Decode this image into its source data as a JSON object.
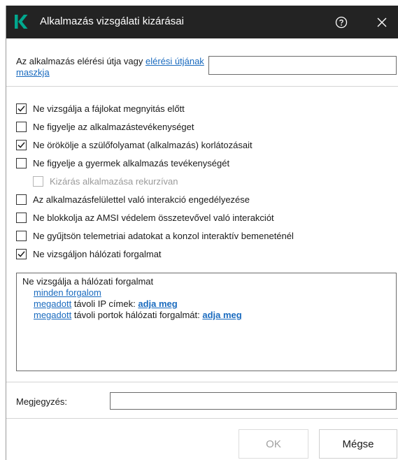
{
  "window": {
    "title": "Alkalmazás vizsgálati kizárásai",
    "accent_color": "#00a88e",
    "titlebar_color": "#232323",
    "icons": [
      "kaspersky-logo",
      "help-icon",
      "close-icon"
    ]
  },
  "path": {
    "label_prefix": "Az alkalmazás elérési útja vagy ",
    "label_link": "elérési útjának maszkja",
    "value": ""
  },
  "options": [
    {
      "label": "Ne vizsgálja a fájlokat megnyitás előtt",
      "checked": true,
      "disabled": false
    },
    {
      "label": "Ne figyelje az alkalmazástevékenységet",
      "checked": false,
      "disabled": false
    },
    {
      "label": "Ne örökölje a szülőfolyamat (alkalmazás) korlátozásait",
      "checked": true,
      "disabled": false
    },
    {
      "label": "Ne figyelje a gyermek alkalmazás tevékenységét",
      "checked": false,
      "disabled": false
    },
    {
      "label": "Kizárás alkalmazása rekurzívan",
      "checked": false,
      "disabled": true
    },
    {
      "label": "Az alkalmazásfelülettel való interakció engedélyezése",
      "checked": false,
      "disabled": false
    },
    {
      "label": "Ne blokkolja az AMSI védelem összetevővel való interakciót",
      "checked": false,
      "disabled": false
    },
    {
      "label": "Ne gyűjtsön telemetriai adatokat a konzol interaktív bemeneténél",
      "checked": false,
      "disabled": false
    },
    {
      "label": "Ne vizsgáljon hálózati forgalmat",
      "checked": true,
      "disabled": false
    }
  ],
  "traffic": {
    "heading": "Ne vizsgálja a hálózati forgalmat",
    "all_traffic": "minden forgalom",
    "ip_link": "megadott",
    "ip_text": " távoli IP címek: ",
    "ip_action": "adja meg",
    "ports_link": "megadott",
    "ports_text": " távoli portok hálózati forgalmát: ",
    "ports_action": "adja meg"
  },
  "note": {
    "label": "Megjegyzés:",
    "value": ""
  },
  "buttons": {
    "ok": "OK",
    "cancel": "Mégse"
  }
}
